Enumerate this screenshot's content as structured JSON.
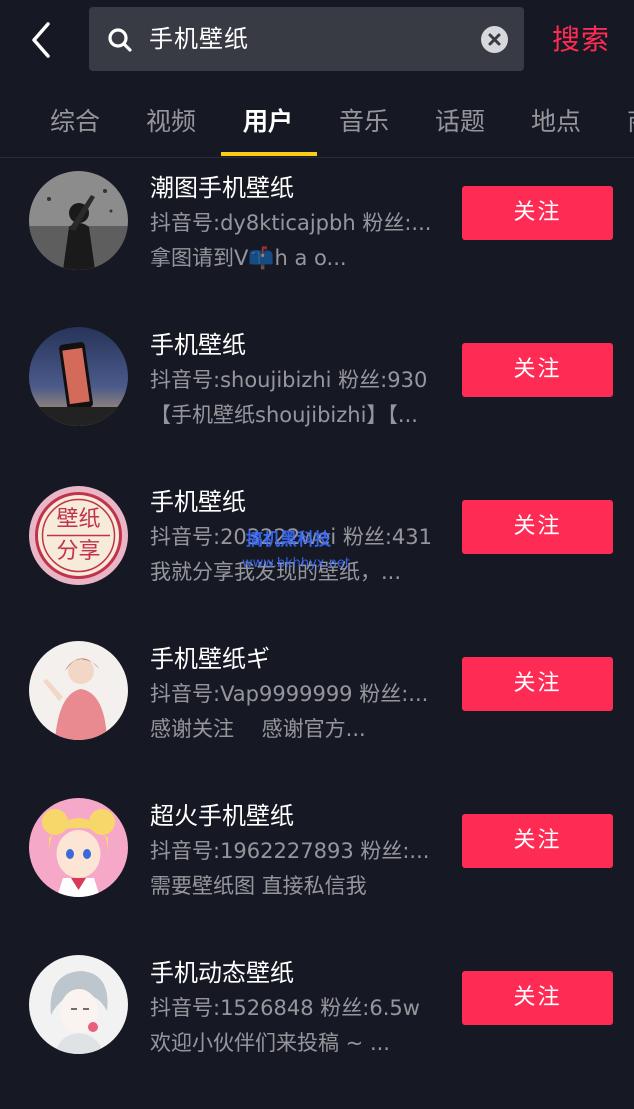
{
  "header": {
    "search_value": "手机壁纸",
    "search_submit": "搜索"
  },
  "tabs": [
    {
      "label": "综合"
    },
    {
      "label": "视频"
    },
    {
      "label": "用户"
    },
    {
      "label": "音乐"
    },
    {
      "label": "话题"
    },
    {
      "label": "地点"
    },
    {
      "label": "商"
    }
  ],
  "active_tab": "用户",
  "users": [
    {
      "name": "潮图手机壁纸",
      "meta": "抖音号:dy8kticajpbh 粉丝:...",
      "desc": "拿图请到V📫h a o...",
      "follow": "关注"
    },
    {
      "name": "手机壁纸",
      "meta": "抖音号:shoujibizhi 粉丝:930",
      "desc": "【手机壁纸shoujibizhi】【...",
      "follow": "关注"
    },
    {
      "name": "手机壁纸",
      "meta": "抖音号:203222wei 粉丝:431",
      "desc": "我就分享我发现的壁纸，...",
      "follow": "关注",
      "avatar_text": [
        "壁纸",
        "分享"
      ]
    },
    {
      "name": "手机壁纸ギ",
      "meta": "抖音号:Vap9999999 粉丝:...",
      "desc": "感谢关注　 感谢官方...",
      "follow": "关注"
    },
    {
      "name": "超火手机壁纸",
      "meta": "抖音号:1962227893 粉丝:...",
      "desc": "需要壁纸图 直接私信我",
      "follow": "关注"
    },
    {
      "name": "手机动态壁纸",
      "meta": "抖音号:1526848 粉丝:6.5w",
      "desc": "欢迎小伙伴们来投稿 ~ ...",
      "follow": "关注"
    }
  ],
  "watermark": {
    "title": "搞机黑科技",
    "url": "www.bkhhyx.net"
  },
  "colors": {
    "background": "#161823",
    "accent": "#fe2c55",
    "tab_indicator": "#face15",
    "search_box": "#393b44"
  }
}
